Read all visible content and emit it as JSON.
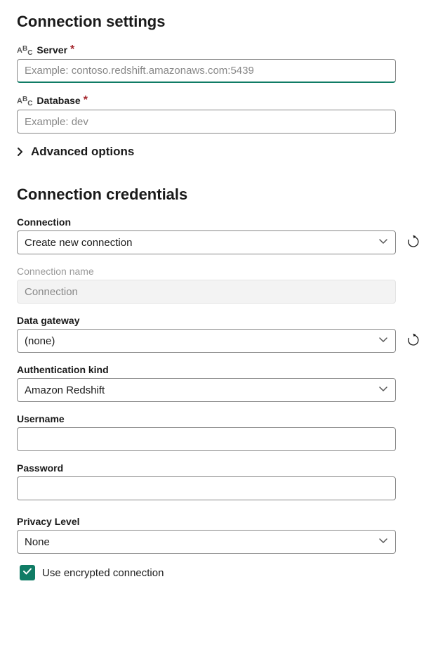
{
  "settings": {
    "title": "Connection settings",
    "server": {
      "label": "Server",
      "placeholder": "Example: contoso.redshift.amazonaws.com:5439",
      "value": ""
    },
    "database": {
      "label": "Database",
      "placeholder": "Example: dev",
      "value": ""
    },
    "advanced_label": "Advanced options"
  },
  "credentials": {
    "title": "Connection credentials",
    "connection": {
      "label": "Connection",
      "value": "Create new connection"
    },
    "connection_name": {
      "label": "Connection name",
      "placeholder": "Connection",
      "value": ""
    },
    "gateway": {
      "label": "Data gateway",
      "value": "(none)"
    },
    "auth_kind": {
      "label": "Authentication kind",
      "value": "Amazon Redshift"
    },
    "username": {
      "label": "Username",
      "value": ""
    },
    "password": {
      "label": "Password",
      "value": ""
    },
    "privacy": {
      "label": "Privacy Level",
      "value": "None"
    },
    "encrypted_label": "Use encrypted connection",
    "encrypted_checked": true
  }
}
